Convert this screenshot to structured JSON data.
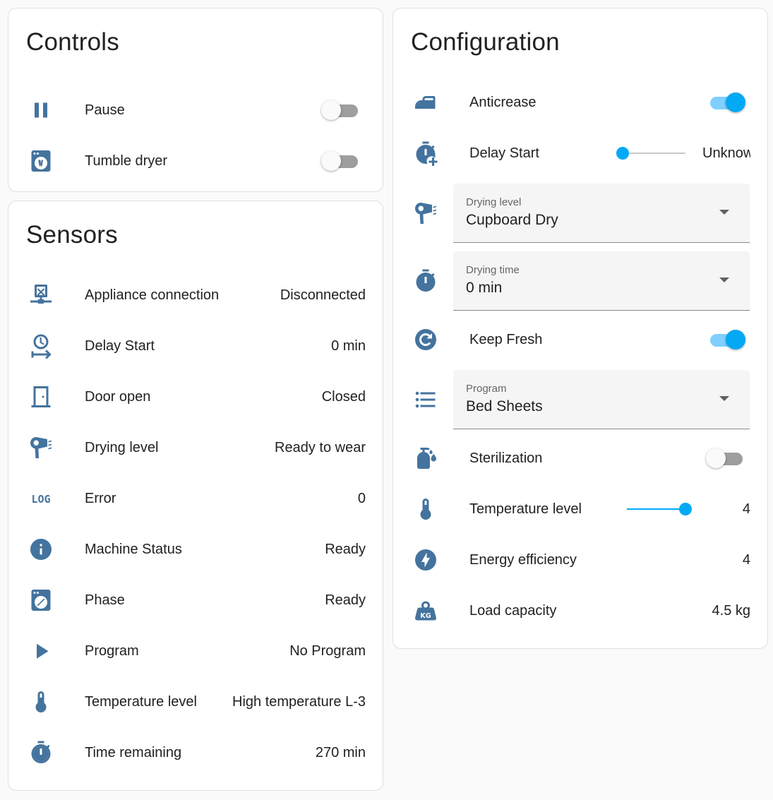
{
  "controls": {
    "title": "Controls",
    "items": [
      {
        "label": "Pause",
        "icon": "pause-icon",
        "on": false
      },
      {
        "label": "Tumble dryer",
        "icon": "tumble-dryer-icon",
        "on": false
      }
    ]
  },
  "sensors": {
    "title": "Sensors",
    "items": [
      {
        "label": "Appliance connection",
        "value": "Disconnected",
        "icon": "network-off-icon"
      },
      {
        "label": "Delay Start",
        "value": "0 min",
        "icon": "clock-arrow-icon"
      },
      {
        "label": "Door open",
        "value": "Closed",
        "icon": "door-closed-icon"
      },
      {
        "label": "Drying level",
        "value": "Ready to wear",
        "icon": "hair-dryer-icon"
      },
      {
        "label": "Error",
        "value": "0",
        "icon": "log-icon"
      },
      {
        "label": "Machine Status",
        "value": "Ready",
        "icon": "information-icon"
      },
      {
        "label": "Phase",
        "value": "Ready",
        "icon": "dryer-phase-icon"
      },
      {
        "label": "Program",
        "value": "No Program",
        "icon": "play-icon"
      },
      {
        "label": "Temperature level",
        "value": "High temperature L-3",
        "icon": "thermometer-icon"
      },
      {
        "label": "Time remaining",
        "value": "270 min",
        "icon": "timer-icon"
      }
    ]
  },
  "configuration": {
    "title": "Configuration",
    "anticrease": {
      "label": "Anticrease",
      "icon": "iron-icon",
      "on": true
    },
    "delay_start": {
      "label": "Delay Start",
      "icon": "timer-plus-icon",
      "value": "Unknown",
      "level": 0
    },
    "drying_level": {
      "label": "Drying level",
      "value": "Cupboard Dry",
      "icon": "hair-dryer-icon"
    },
    "drying_time": {
      "label": "Drying time",
      "value": "0 min",
      "icon": "timer-icon"
    },
    "keep_fresh": {
      "label": "Keep Fresh",
      "icon": "refresh-circle-icon",
      "on": true
    },
    "program": {
      "label": "Program",
      "value": "Bed Sheets",
      "icon": "list-icon"
    },
    "sterilization": {
      "label": "Sterilization",
      "icon": "sanitizer-icon",
      "on": false
    },
    "temperature_level": {
      "label": "Temperature level",
      "value": "4",
      "icon": "thermometer-icon",
      "level": 1
    },
    "energy_efficiency": {
      "label": "Energy efficiency",
      "value": "4",
      "icon": "flash-circle-icon"
    },
    "load_capacity": {
      "label": "Load capacity",
      "value": "4.5 kg",
      "icon": "weight-kg-icon"
    }
  },
  "colors": {
    "icon": "#44739e",
    "accent": "#03a9f4",
    "text": "#212121"
  }
}
